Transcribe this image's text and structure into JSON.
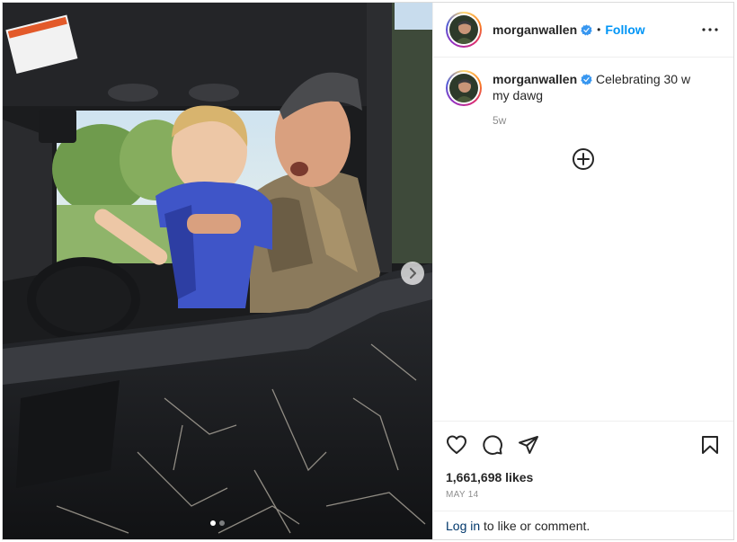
{
  "post": {
    "username": "morganwallen",
    "verified": true,
    "separator": "•",
    "follow_label": "Follow",
    "caption": "Celebrating 30 w my dawg",
    "caption_time": "5w",
    "likes": "1,661,698 likes",
    "date": "MAY 14",
    "login_link": "Log in",
    "login_suffix": " to like or comment."
  },
  "carousel": {
    "current": 1,
    "total": 2
  },
  "icons": {
    "more": "more-options-icon",
    "verified": "verified-badge-icon",
    "load_more": "plus-circle-icon",
    "like": "heart-icon",
    "comment": "comment-icon",
    "share": "share-icon",
    "save": "bookmark-icon",
    "next": "chevron-right-icon"
  },
  "colors": {
    "accent": "#0095f6",
    "verified": "#3897f0",
    "muted": "#8e8e8e",
    "link": "#00376b"
  }
}
